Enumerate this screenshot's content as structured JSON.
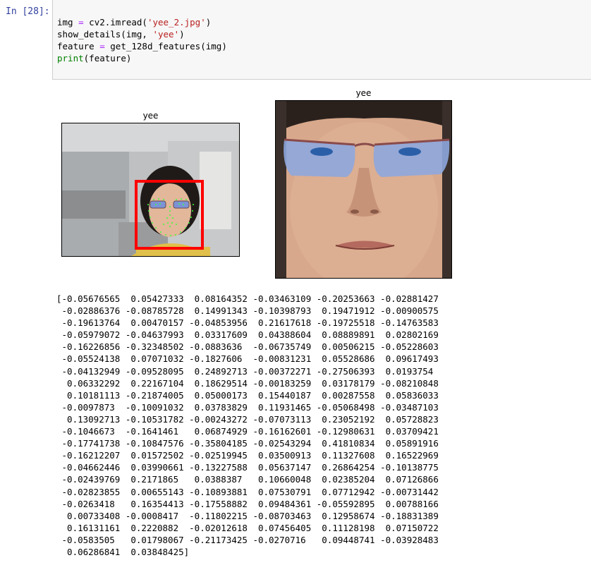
{
  "cell": {
    "prompt": "In [28]:",
    "code_lines": [
      [
        {
          "t": "img ",
          "c": "tok-fn"
        },
        {
          "t": "=",
          "c": "tok-op"
        },
        {
          "t": " cv2.imread(",
          "c": "tok-fn"
        },
        {
          "t": "'yee_2.jpg'",
          "c": "tok-str"
        },
        {
          "t": ")",
          "c": "tok-fn"
        }
      ],
      [
        {
          "t": "show_details(img, ",
          "c": "tok-fn"
        },
        {
          "t": "'yee'",
          "c": "tok-str"
        },
        {
          "t": ")",
          "c": "tok-fn"
        }
      ],
      [
        {
          "t": "feature ",
          "c": "tok-fn"
        },
        {
          "t": "=",
          "c": "tok-op"
        },
        {
          "t": " get_128d_features(img)",
          "c": "tok-fn"
        }
      ],
      [
        {
          "t": "print",
          "c": "tok-builtin"
        },
        {
          "t": "(feature)",
          "c": "tok-fn"
        }
      ]
    ]
  },
  "figures": {
    "left_title": "yee",
    "right_title": "yee"
  },
  "colors": {
    "prompt": "#303f9f",
    "input_bg": "#f7f7f7",
    "box_red": "#ff0000",
    "landmark_green": "#3cff3c",
    "string_red": "#ba2121",
    "builtin_green": "#008000",
    "operator_purple": "#aa22ff"
  },
  "output_lines": [
    "[-0.05676565  0.05427333  0.08164352 -0.03463109 -0.20253663 -0.02881427",
    " -0.02886376 -0.08785728  0.14991343 -0.10398793  0.19471912 -0.00900575",
    " -0.19613764  0.00470157 -0.04853956  0.21617618 -0.19725518 -0.14763583",
    " -0.05979072 -0.04637993  0.03317609  0.04388604  0.08889891  0.02802169",
    " -0.16226856 -0.32348502 -0.0883636  -0.06735749  0.00506215 -0.05228603",
    " -0.05524138  0.07071032 -0.1827606  -0.00831231  0.05528686  0.09617493",
    " -0.04132949 -0.09528095  0.24892713 -0.00372271 -0.27506393  0.0193754",
    "  0.06332292  0.22167104  0.18629514 -0.00183259  0.03178179 -0.08210848",
    "  0.10181113 -0.21874005  0.05000173  0.15440187  0.00287558  0.05836033",
    " -0.0097873  -0.10091032  0.03783829  0.11931465 -0.05068498 -0.03487103",
    "  0.13092713 -0.10531782 -0.00243272 -0.07073113  0.23052192  0.05728823",
    " -0.1046673  -0.1641461   0.06874929 -0.16162601 -0.12980631  0.03709421",
    " -0.17741738 -0.10847576 -0.35804185 -0.02543294  0.41810834  0.05891916",
    " -0.16212207  0.01572502 -0.02519945  0.03500913  0.11327608  0.16522969",
    " -0.04662446  0.03990661 -0.13227588  0.05637147  0.26864254 -0.10138775",
    " -0.02439769  0.2171865   0.0388387   0.10660048  0.02385204  0.07126866",
    " -0.02823855  0.00655143 -0.10893881  0.07530791  0.07712942 -0.00731442",
    " -0.0263418   0.16354413 -0.17558882  0.09484361 -0.05592895  0.00788166",
    "  0.00733408 -0.0008417  -0.11802215 -0.08703463  0.12958674 -0.18831389",
    "  0.16131161  0.2220882  -0.02012618  0.07456405  0.11128198  0.07150722",
    " -0.0583505   0.01798067 -0.21173425 -0.0270716   0.09448741 -0.03928483",
    "  0.06286841  0.03848425]"
  ]
}
